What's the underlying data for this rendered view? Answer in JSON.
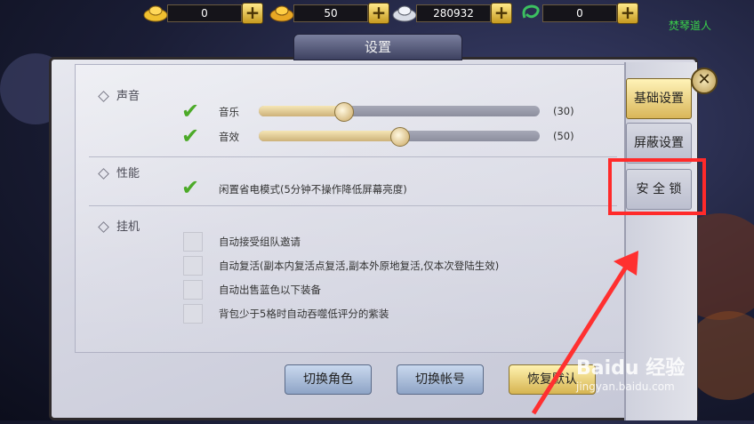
{
  "currencies": [
    {
      "name": "gold-ingot",
      "value": "0"
    },
    {
      "name": "gold-ingot-bound",
      "value": "50"
    },
    {
      "name": "silver-ingot",
      "value": "280932"
    },
    {
      "name": "jade",
      "value": "0"
    }
  ],
  "player_name": "焚琴道人",
  "dialog_title": "设置",
  "sections": {
    "sound": {
      "title": "声音",
      "music": {
        "label": "音乐",
        "value": "(30)",
        "level": 0.3,
        "checked": true
      },
      "sfx": {
        "label": "音效",
        "value": "(50)",
        "level": 0.5,
        "checked": true
      }
    },
    "performance": {
      "title": "性能",
      "power_save": {
        "label": "闲置省电模式(5分钟不操作降低屏幕亮度)",
        "checked": true
      }
    },
    "idle": {
      "title": "挂机",
      "items": [
        {
          "label": "自动接受组队邀请",
          "checked": false
        },
        {
          "label": "自动复活(副本内复活点复活,副本外原地复活,仅本次登陆生效)",
          "checked": false
        },
        {
          "label": "自动出售蓝色以下装备",
          "checked": false
        },
        {
          "label": "背包少于5格时自动吞噬低评分的紫装",
          "checked": false
        }
      ]
    }
  },
  "tabs": [
    {
      "label": "基础设置",
      "active": true
    },
    {
      "label": "屏蔽设置",
      "active": false
    },
    {
      "label": "安 全 锁",
      "active": false
    }
  ],
  "buttons": {
    "switch_role": "切换角色",
    "switch_account": "切换帐号",
    "restore_default": "恢复默认"
  },
  "watermark": {
    "brand": "Baidu 经验",
    "url": "jingyan.baidu.com"
  },
  "colors": {
    "highlight": "#ff2a2a",
    "check": "#4caa28",
    "active_tab": "#d9b659"
  }
}
